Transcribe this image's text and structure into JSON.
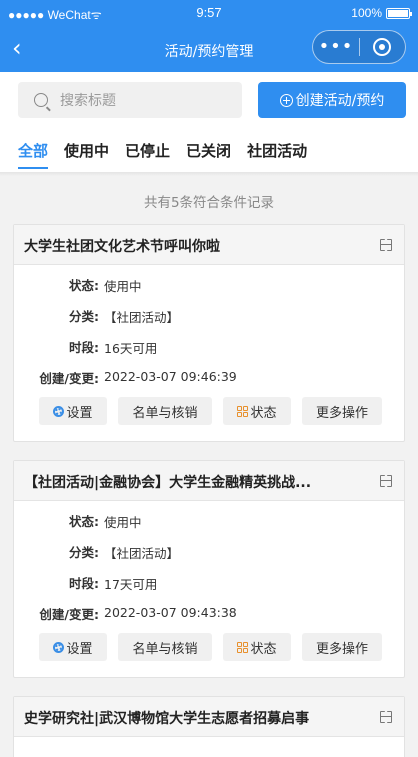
{
  "status_bar": {
    "carrier": "●●●●● WeChat",
    "wifi": "ᯤ",
    "time": "9:57",
    "battery": "100%"
  },
  "nav": {
    "back_icon": "‹",
    "title": "活动/预约管理",
    "more_dots": "•••"
  },
  "search": {
    "placeholder": "搜索标题"
  },
  "create_button": {
    "label": "创建活动/预约"
  },
  "tabs": [
    {
      "label": "全部",
      "active": true
    },
    {
      "label": "使用中"
    },
    {
      "label": "已停止"
    },
    {
      "label": "已关闭"
    },
    {
      "label": "社团活动"
    }
  ],
  "result_count": "共有5条符合条件记录",
  "labels": {
    "status": "状态:",
    "category": "分类:",
    "period": "时段:",
    "created": "创建/变更:"
  },
  "cards": [
    {
      "title": "大学生社团文化艺术节呼叫你啦",
      "status": "使用中",
      "category": "【社团活动】",
      "period": "16天可用",
      "created": "2022-03-07 09:46:39",
      "buttons": {
        "settings": "设置",
        "roster": "名单与核销",
        "state": "状态",
        "more": "更多操作"
      }
    },
    {
      "title": "【社团活动|金融协会】大学生金融精英挑战...",
      "status": "使用中",
      "category": "【社团活动】",
      "period": "17天可用",
      "created": "2022-03-07 09:43:38",
      "buttons": {
        "settings": "设置",
        "roster": "名单与核销",
        "state": "状态",
        "more": "更多操作"
      }
    },
    {
      "title": "史学研究社|武汉博物馆大学生志愿者招募启事"
    }
  ]
}
